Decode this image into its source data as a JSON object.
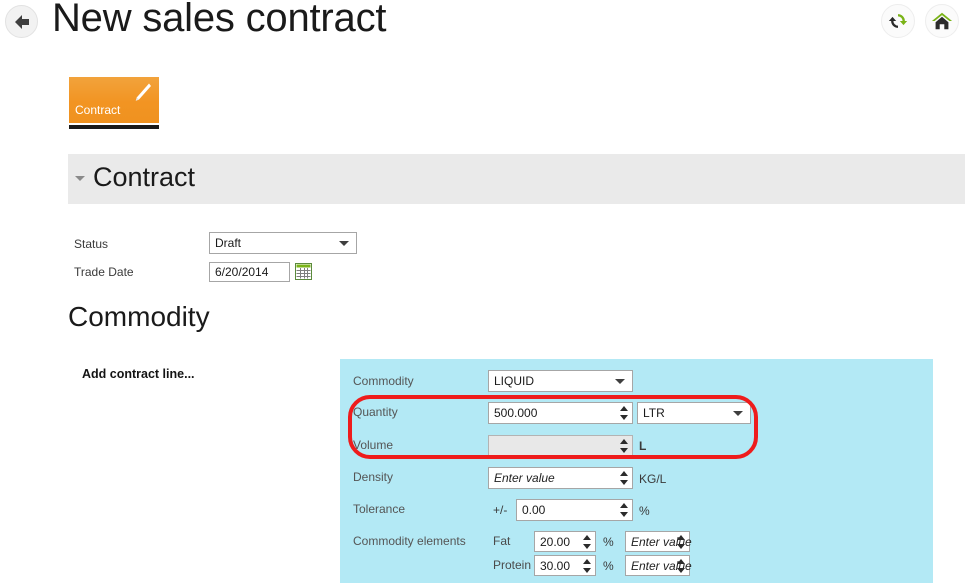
{
  "header": {
    "title": "New sales contract",
    "back_icon": "back-arrow-icon",
    "refresh_icon": "refresh-icon",
    "home_icon": "home-icon"
  },
  "tab": {
    "label": "Contract",
    "icon": "pencil-icon"
  },
  "section": {
    "title": "Contract",
    "collapse_icon": "caret-down-icon"
  },
  "contract": {
    "status_label": "Status",
    "status_value": "Draft",
    "trade_date_label": "Trade Date",
    "trade_date_value": "6/20/2014",
    "calendar_icon": "calendar-icon"
  },
  "commodity": {
    "heading": "Commodity",
    "add_line": "Add contract line...",
    "rows": {
      "commodity": {
        "label": "Commodity",
        "value": "LIQUID"
      },
      "quantity": {
        "label": "Quantity",
        "value": "500.000",
        "uom": "LTR"
      },
      "volume": {
        "label": "Volume",
        "value": "",
        "unit": "L"
      },
      "density": {
        "label": "Density",
        "placeholder": "Enter value",
        "unit": "KG/L"
      },
      "tolerance": {
        "label": "Tolerance",
        "prefix": "+/-",
        "value": "0.00",
        "unit": "%"
      },
      "elements": {
        "label": "Commodity elements",
        "items": [
          {
            "name": "Fat",
            "value": "20.00",
            "unit": "%",
            "extra_placeholder": "Enter value"
          },
          {
            "name": "Protein",
            "value": "30.00",
            "unit": "%",
            "extra_placeholder": "Enter value"
          }
        ]
      }
    }
  },
  "annotation": {
    "highlight_color": "#ee1c1c",
    "highlight_target": "quantity-and-volume-rows"
  },
  "colors": {
    "panel_bg": "#b3e9f5",
    "tab_orange": "#f29422",
    "section_bg": "#eaeaea",
    "icon_green": "#7ab317"
  }
}
